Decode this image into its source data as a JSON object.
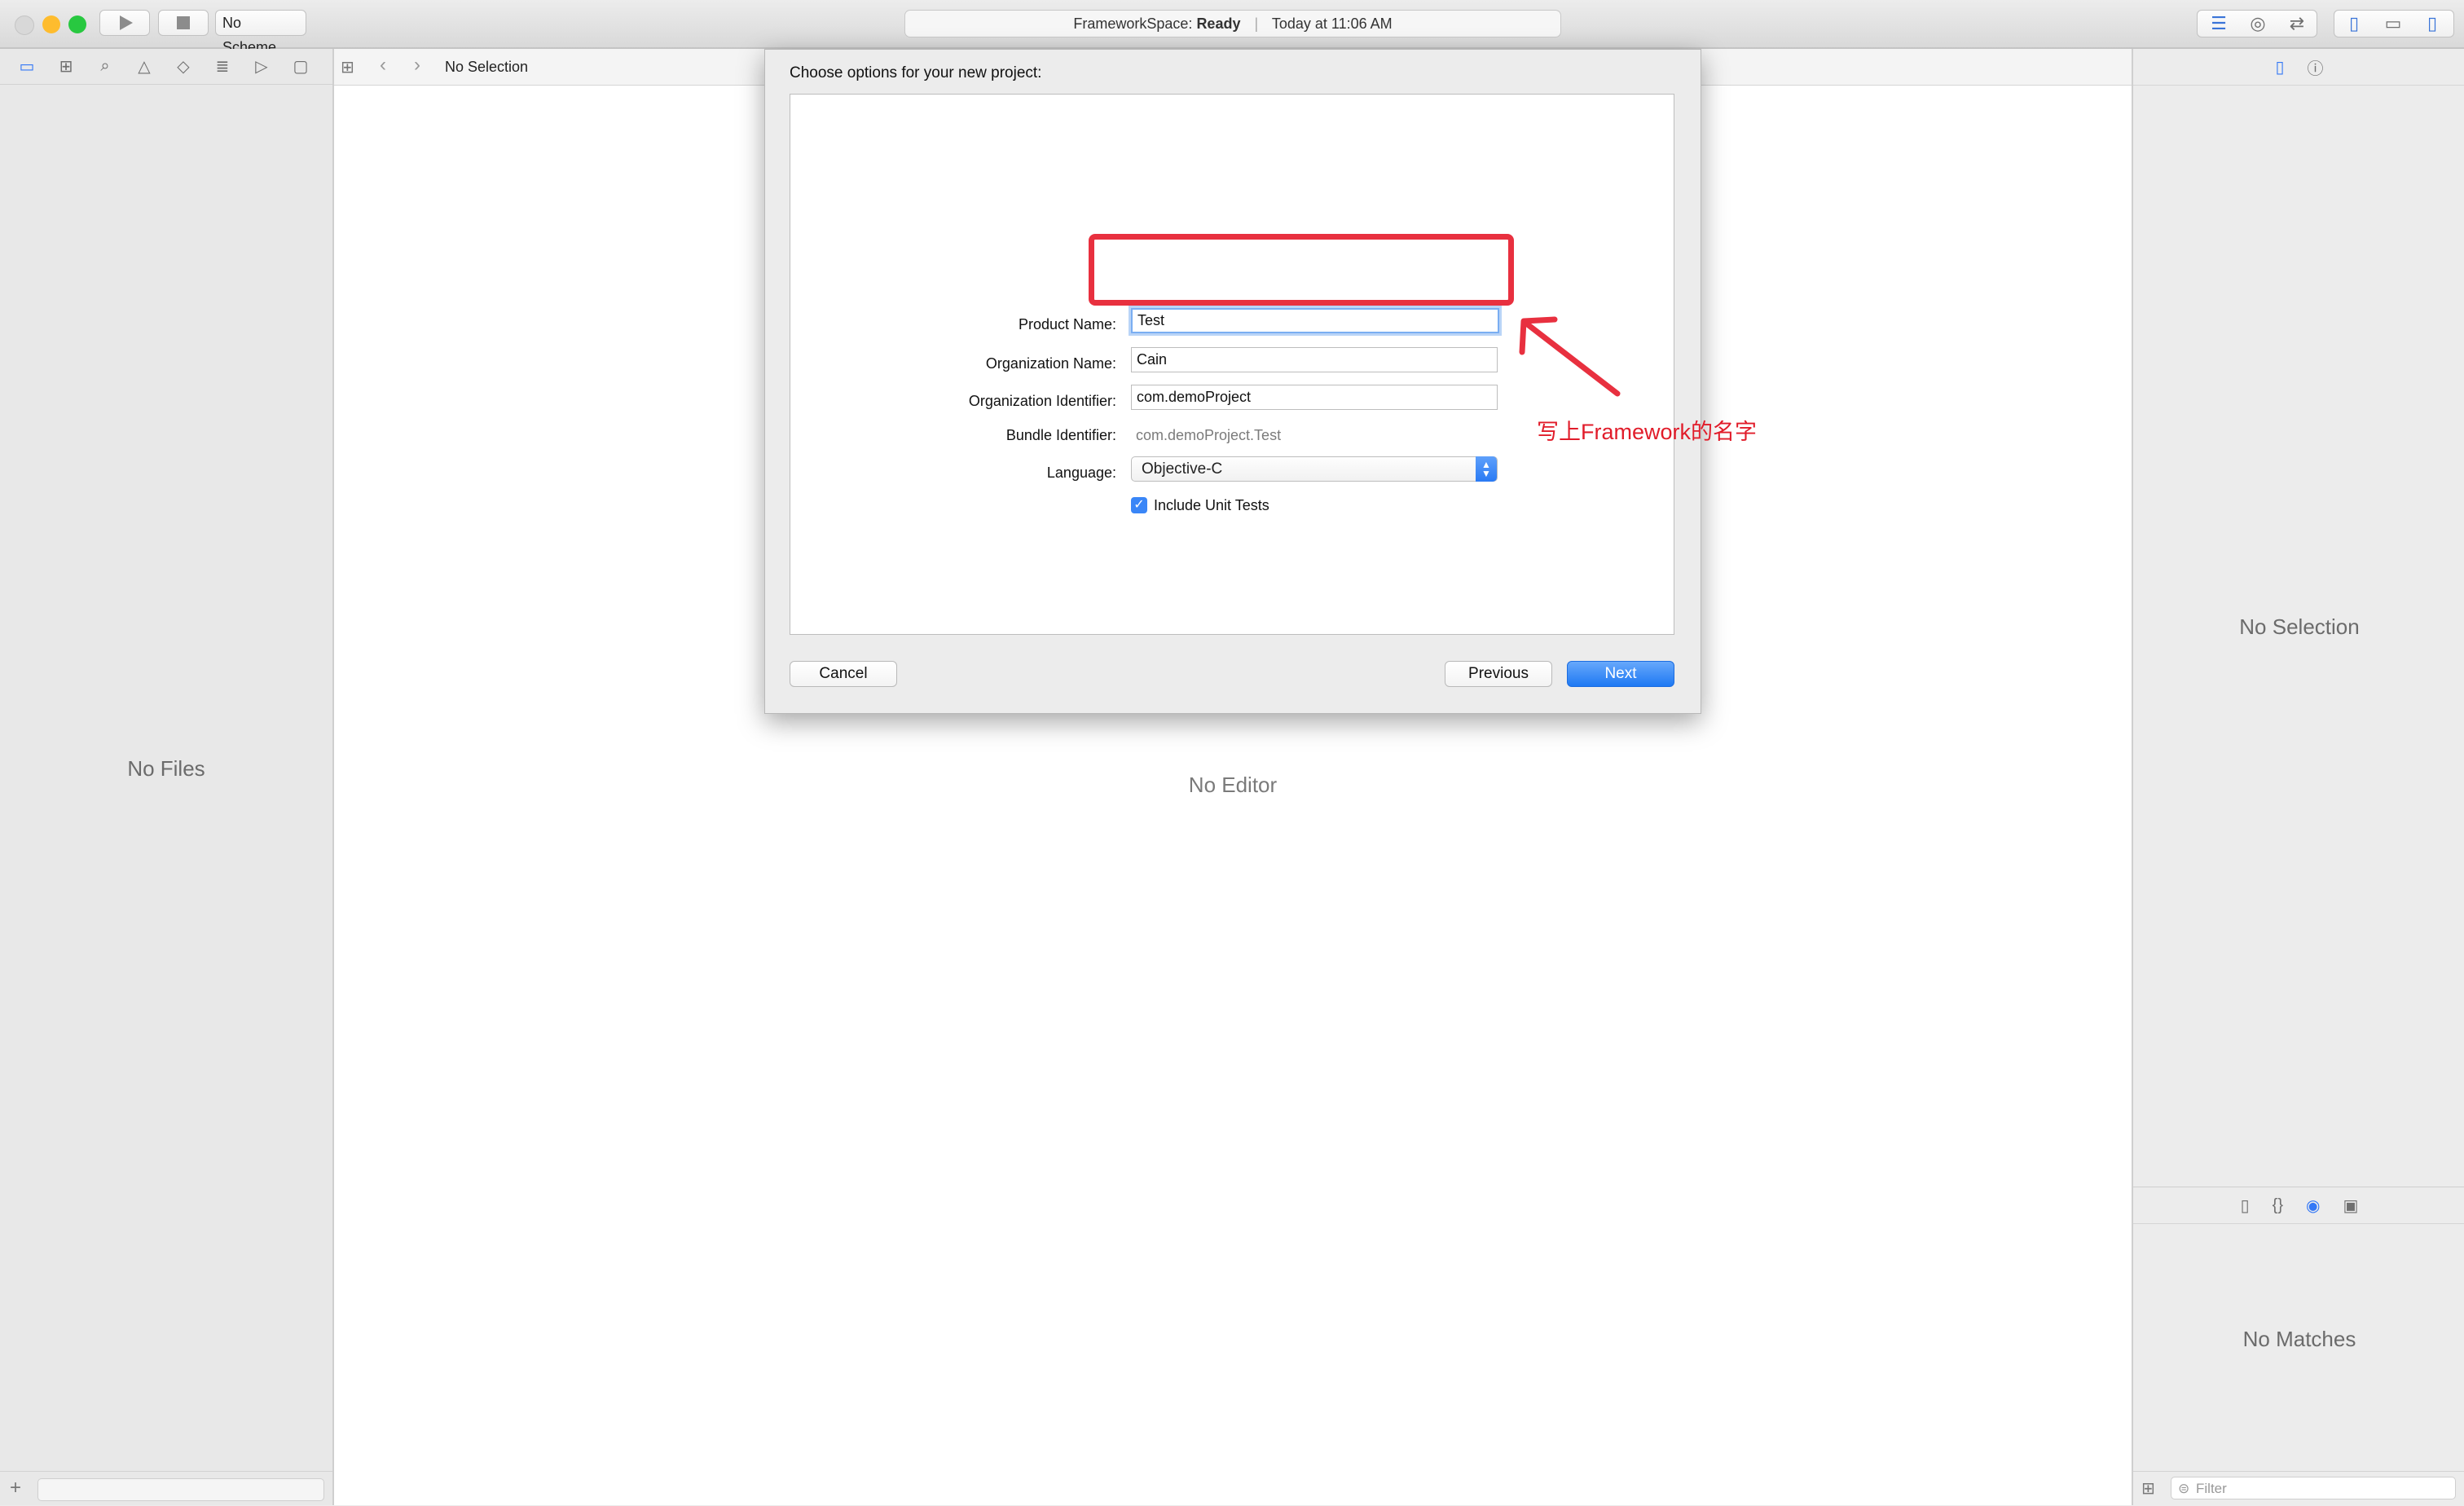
{
  "toolbar": {
    "scheme": "No Scheme",
    "activity": {
      "project": "FrameworkSpace:",
      "status": "Ready",
      "time": "Today at 11:06 AM"
    },
    "colors": {
      "close": "#fd5f57",
      "minimize": "#febc2e",
      "zoom": "#28c840"
    }
  },
  "navigator": {
    "icons": [
      "folder-icon",
      "symbol-icon",
      "find-icon",
      "issue-icon",
      "test-icon",
      "debug-icon",
      "breakpoint-icon",
      "report-icon"
    ],
    "empty_text": "No Files"
  },
  "editor": {
    "jump_bar_text": "No Selection",
    "empty_text": "No Editor"
  },
  "inspector": {
    "top_empty": "No Selection",
    "library_empty": "No Matches",
    "filter_placeholder": "Filter"
  },
  "sheet": {
    "title": "Choose options for your new project:",
    "fields": {
      "product_name": {
        "label": "Product Name:",
        "value": "Test"
      },
      "org_name": {
        "label": "Organization Name:",
        "value": "Cain"
      },
      "org_id": {
        "label": "Organization Identifier:",
        "value": "com.demoProject"
      },
      "bundle_id": {
        "label": "Bundle Identifier:",
        "value": "com.demoProject.Test"
      },
      "language": {
        "label": "Language:",
        "value": "Objective-C"
      },
      "unit_tests": {
        "label": "Include Unit Tests",
        "checked": true
      }
    },
    "buttons": {
      "cancel": "Cancel",
      "previous": "Previous",
      "next": "Next"
    }
  },
  "annotation": {
    "text": "写上Framework的名字",
    "color": "#e8303f"
  }
}
